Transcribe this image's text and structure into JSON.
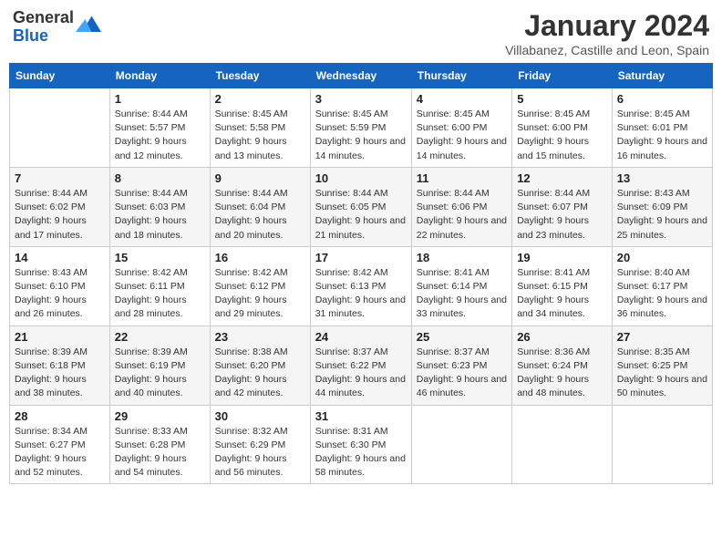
{
  "logo": {
    "general": "General",
    "blue": "Blue"
  },
  "header": {
    "month": "January 2024",
    "location": "Villabanez, Castille and Leon, Spain"
  },
  "weekdays": [
    "Sunday",
    "Monday",
    "Tuesday",
    "Wednesday",
    "Thursday",
    "Friday",
    "Saturday"
  ],
  "weeks": [
    [
      {
        "day": null
      },
      {
        "day": "1",
        "sunrise": "Sunrise: 8:44 AM",
        "sunset": "Sunset: 5:57 PM",
        "daylight": "Daylight: 9 hours and 12 minutes."
      },
      {
        "day": "2",
        "sunrise": "Sunrise: 8:45 AM",
        "sunset": "Sunset: 5:58 PM",
        "daylight": "Daylight: 9 hours and 13 minutes."
      },
      {
        "day": "3",
        "sunrise": "Sunrise: 8:45 AM",
        "sunset": "Sunset: 5:59 PM",
        "daylight": "Daylight: 9 hours and 14 minutes."
      },
      {
        "day": "4",
        "sunrise": "Sunrise: 8:45 AM",
        "sunset": "Sunset: 6:00 PM",
        "daylight": "Daylight: 9 hours and 14 minutes."
      },
      {
        "day": "5",
        "sunrise": "Sunrise: 8:45 AM",
        "sunset": "Sunset: 6:00 PM",
        "daylight": "Daylight: 9 hours and 15 minutes."
      },
      {
        "day": "6",
        "sunrise": "Sunrise: 8:45 AM",
        "sunset": "Sunset: 6:01 PM",
        "daylight": "Daylight: 9 hours and 16 minutes."
      }
    ],
    [
      {
        "day": "7",
        "sunrise": "Sunrise: 8:44 AM",
        "sunset": "Sunset: 6:02 PM",
        "daylight": "Daylight: 9 hours and 17 minutes."
      },
      {
        "day": "8",
        "sunrise": "Sunrise: 8:44 AM",
        "sunset": "Sunset: 6:03 PM",
        "daylight": "Daylight: 9 hours and 18 minutes."
      },
      {
        "day": "9",
        "sunrise": "Sunrise: 8:44 AM",
        "sunset": "Sunset: 6:04 PM",
        "daylight": "Daylight: 9 hours and 20 minutes."
      },
      {
        "day": "10",
        "sunrise": "Sunrise: 8:44 AM",
        "sunset": "Sunset: 6:05 PM",
        "daylight": "Daylight: 9 hours and 21 minutes."
      },
      {
        "day": "11",
        "sunrise": "Sunrise: 8:44 AM",
        "sunset": "Sunset: 6:06 PM",
        "daylight": "Daylight: 9 hours and 22 minutes."
      },
      {
        "day": "12",
        "sunrise": "Sunrise: 8:44 AM",
        "sunset": "Sunset: 6:07 PM",
        "daylight": "Daylight: 9 hours and 23 minutes."
      },
      {
        "day": "13",
        "sunrise": "Sunrise: 8:43 AM",
        "sunset": "Sunset: 6:09 PM",
        "daylight": "Daylight: 9 hours and 25 minutes."
      }
    ],
    [
      {
        "day": "14",
        "sunrise": "Sunrise: 8:43 AM",
        "sunset": "Sunset: 6:10 PM",
        "daylight": "Daylight: 9 hours and 26 minutes."
      },
      {
        "day": "15",
        "sunrise": "Sunrise: 8:42 AM",
        "sunset": "Sunset: 6:11 PM",
        "daylight": "Daylight: 9 hours and 28 minutes."
      },
      {
        "day": "16",
        "sunrise": "Sunrise: 8:42 AM",
        "sunset": "Sunset: 6:12 PM",
        "daylight": "Daylight: 9 hours and 29 minutes."
      },
      {
        "day": "17",
        "sunrise": "Sunrise: 8:42 AM",
        "sunset": "Sunset: 6:13 PM",
        "daylight": "Daylight: 9 hours and 31 minutes."
      },
      {
        "day": "18",
        "sunrise": "Sunrise: 8:41 AM",
        "sunset": "Sunset: 6:14 PM",
        "daylight": "Daylight: 9 hours and 33 minutes."
      },
      {
        "day": "19",
        "sunrise": "Sunrise: 8:41 AM",
        "sunset": "Sunset: 6:15 PM",
        "daylight": "Daylight: 9 hours and 34 minutes."
      },
      {
        "day": "20",
        "sunrise": "Sunrise: 8:40 AM",
        "sunset": "Sunset: 6:17 PM",
        "daylight": "Daylight: 9 hours and 36 minutes."
      }
    ],
    [
      {
        "day": "21",
        "sunrise": "Sunrise: 8:39 AM",
        "sunset": "Sunset: 6:18 PM",
        "daylight": "Daylight: 9 hours and 38 minutes."
      },
      {
        "day": "22",
        "sunrise": "Sunrise: 8:39 AM",
        "sunset": "Sunset: 6:19 PM",
        "daylight": "Daylight: 9 hours and 40 minutes."
      },
      {
        "day": "23",
        "sunrise": "Sunrise: 8:38 AM",
        "sunset": "Sunset: 6:20 PM",
        "daylight": "Daylight: 9 hours and 42 minutes."
      },
      {
        "day": "24",
        "sunrise": "Sunrise: 8:37 AM",
        "sunset": "Sunset: 6:22 PM",
        "daylight": "Daylight: 9 hours and 44 minutes."
      },
      {
        "day": "25",
        "sunrise": "Sunrise: 8:37 AM",
        "sunset": "Sunset: 6:23 PM",
        "daylight": "Daylight: 9 hours and 46 minutes."
      },
      {
        "day": "26",
        "sunrise": "Sunrise: 8:36 AM",
        "sunset": "Sunset: 6:24 PM",
        "daylight": "Daylight: 9 hours and 48 minutes."
      },
      {
        "day": "27",
        "sunrise": "Sunrise: 8:35 AM",
        "sunset": "Sunset: 6:25 PM",
        "daylight": "Daylight: 9 hours and 50 minutes."
      }
    ],
    [
      {
        "day": "28",
        "sunrise": "Sunrise: 8:34 AM",
        "sunset": "Sunset: 6:27 PM",
        "daylight": "Daylight: 9 hours and 52 minutes."
      },
      {
        "day": "29",
        "sunrise": "Sunrise: 8:33 AM",
        "sunset": "Sunset: 6:28 PM",
        "daylight": "Daylight: 9 hours and 54 minutes."
      },
      {
        "day": "30",
        "sunrise": "Sunrise: 8:32 AM",
        "sunset": "Sunset: 6:29 PM",
        "daylight": "Daylight: 9 hours and 56 minutes."
      },
      {
        "day": "31",
        "sunrise": "Sunrise: 8:31 AM",
        "sunset": "Sunset: 6:30 PM",
        "daylight": "Daylight: 9 hours and 58 minutes."
      },
      {
        "day": null
      },
      {
        "day": null
      },
      {
        "day": null
      }
    ]
  ]
}
